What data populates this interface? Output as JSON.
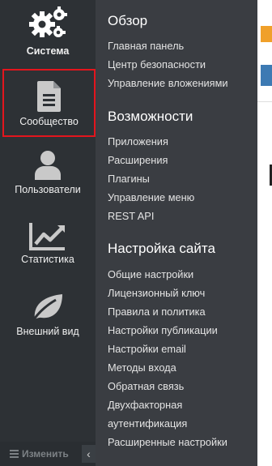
{
  "sidebar": {
    "items": [
      {
        "label": "Система",
        "icon": "gears-icon"
      },
      {
        "label": "Сообщество",
        "icon": "document-icon"
      },
      {
        "label": "Пользователи",
        "icon": "user-icon"
      },
      {
        "label": "Статистика",
        "icon": "line-chart-icon"
      },
      {
        "label": "Внешний вид",
        "icon": "leaf-icon"
      }
    ],
    "edit_label": "Изменить",
    "collapse_glyph": "‹"
  },
  "panel": {
    "sections": [
      {
        "title": "Обзор",
        "links": [
          "Главная панель",
          "Центр безопасности",
          "Управление вложениями"
        ]
      },
      {
        "title": "Возможности",
        "links": [
          "Приложения",
          "Расширения",
          "Плагины",
          "Управление меню",
          "REST API"
        ]
      },
      {
        "title": "Настройка сайта",
        "links": [
          "Общие настройки",
          "Лицензионный ключ",
          "Правила и политика",
          "Настройки публикации",
          "Настройки email",
          "Методы входа",
          "Обратная связь",
          "Двухфакторная",
          "аутентификация",
          "Расширенные настройки"
        ]
      }
    ]
  },
  "colors": {
    "sidebar": "#2d3135",
    "panel": "#3a3d42",
    "highlight": "#e3151d"
  }
}
